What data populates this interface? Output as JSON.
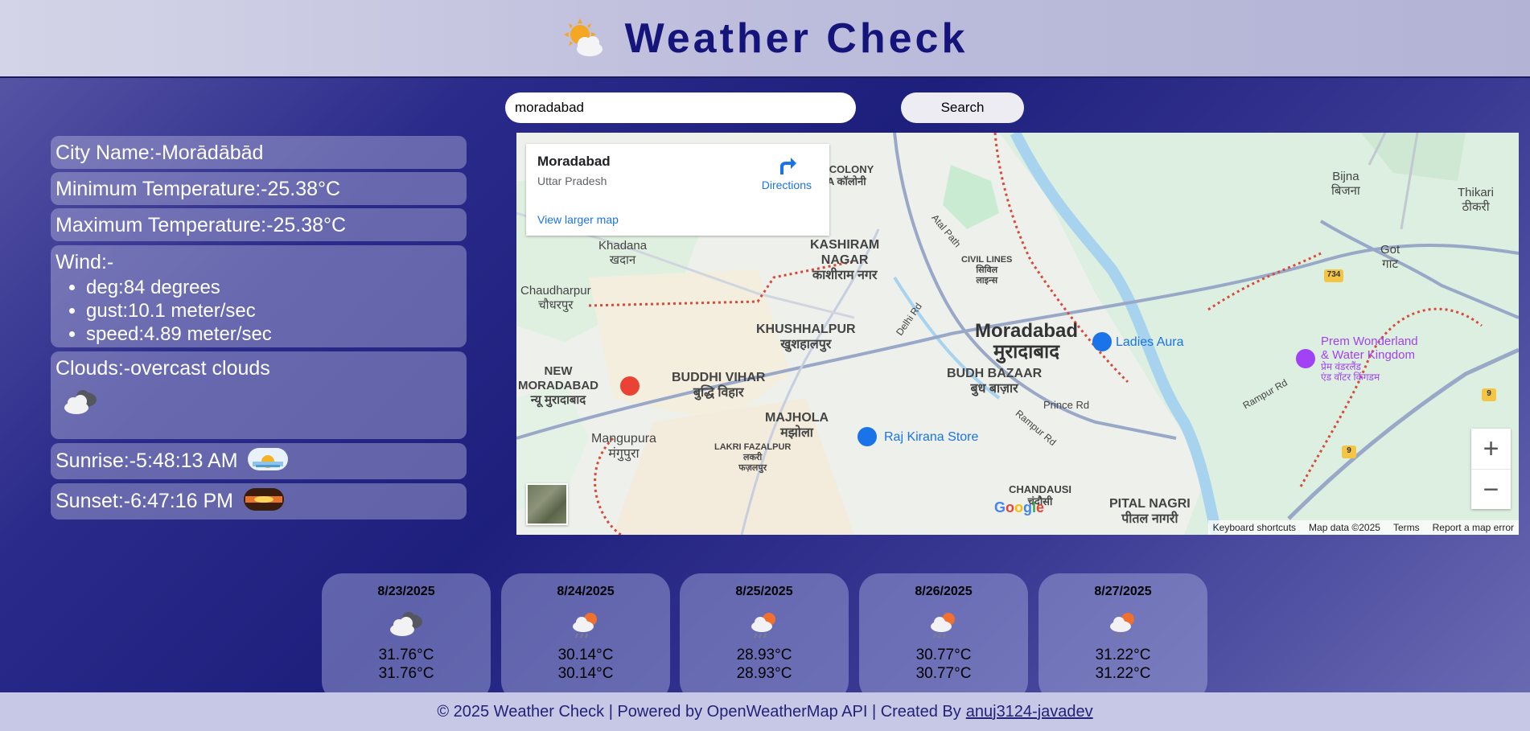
{
  "header": {
    "title": "Weather Check",
    "logo_icon": "sun-cloud-icon"
  },
  "search": {
    "value": "moradabad",
    "button": "Search"
  },
  "info": {
    "city": "City Name:-Morādābād",
    "min_temp": "Minimum Temperature:-25.38°C",
    "max_temp": "Maximum Temperature:-25.38°C",
    "wind_title": "Wind:-",
    "wind_deg": "deg:84 degrees",
    "wind_gust": "gust:10.1 meter/sec",
    "wind_speed": "speed:4.89 meter/sec",
    "clouds": "Clouds:-overcast clouds",
    "sunrise": "Sunrise:-5:48:13 AM",
    "sunset": "Sunset:-6:47:16 PM"
  },
  "map": {
    "place_name": "Moradabad",
    "place_region": "Uttar Pradesh",
    "directions": "Directions",
    "view_larger": "View larger map",
    "city_label_en": "Moradabad",
    "city_label_hi": "मुरादाबाद",
    "footer": {
      "shortcuts": "Keyboard shortcuts",
      "map_data": "Map data ©2025",
      "terms": "Terms",
      "report": "Report a map error"
    },
    "google": "Google",
    "zoom_in": "+",
    "zoom_out": "−",
    "labels": {
      "mda": "MDA COLONY",
      "mda_hi": "MDA कॉलोनी",
      "bijna": "Bijna",
      "bijna_hi": "बिजना",
      "thikari": "Thikari",
      "thikari_hi": "ठीकरी",
      "khadana": "Khadana",
      "khadana_hi": "खदान",
      "kashiram": "KASHIRAM",
      "nagar": "NAGAR",
      "kashiram_hi": "काशीराम नगर",
      "civil": "CIVIL LINES",
      "civil_hi1": "सिविल",
      "civil_hi2": "लाइन्स",
      "got": "Got",
      "got_hi": "गाट",
      "chaudharpur": "Chaudharpur",
      "chaudharpur_hi": "चौधरपुर",
      "khushhalpur": "KHUSHHALPUR",
      "khushhalpur_hi": "खुशहालपुर",
      "ladies": "Ladies Aura",
      "prem1": "Prem Wonderland",
      "prem2": "& Water Kingdom",
      "prem_hi1": "प्रेम वंडरलैंड",
      "prem_hi2": "एंड वॉटर किंगडम",
      "new": "NEW",
      "moradabad": "MORADABAD",
      "new_hi": "न्यू मुरादाबाद",
      "buddhi": "BUDDHI VIHAR",
      "buddhi_hi": "बुद्धि विहार",
      "budh": "BUDH BAZAAR",
      "budh_hi": "बुध बाज़ार",
      "prince": "Prince Rd",
      "majhola": "MAJHOLA",
      "majhola_hi": "मझोला",
      "mangupura": "Mangupura",
      "mangupura_hi": "मंगुपुरा",
      "raj": "Raj Kirana Store",
      "lakri": "LAKRI FAZALPUR",
      "lakri_hi1": "लकरी",
      "lakri_hi2": "फज़लपुर",
      "chandausi": "CHANDAUSI",
      "chandausi_hi": "चंदौसी",
      "pitalnagri": "PITAL NAGRI",
      "pitalnagri_hi": "पीतल नागरी",
      "atal": "Atal Path",
      "delhi": "Delhi Rd",
      "rampur": "Rampur Rd",
      "rampur2": "Rampur Rd",
      "r734": "734",
      "r9a": "9",
      "r9b": "9"
    }
  },
  "forecast": [
    {
      "date": "8/23/2025",
      "icon": "overcast-clouds-icon",
      "t1": "31.76°C",
      "t2": "31.76°C"
    },
    {
      "date": "8/24/2025",
      "icon": "rain-sun-icon",
      "t1": "30.14°C",
      "t2": "30.14°C"
    },
    {
      "date": "8/25/2025",
      "icon": "rain-sun-icon",
      "t1": "28.93°C",
      "t2": "28.93°C"
    },
    {
      "date": "8/26/2025",
      "icon": "rain-sun-icon",
      "t1": "30.77°C",
      "t2": "30.77°C"
    },
    {
      "date": "8/27/2025",
      "icon": "rain-sun-icon",
      "t1": "31.22°C",
      "t2": "31.22°C"
    }
  ],
  "footer": {
    "text": "© 2025 Weather Check | Powered by OpenWeatherMap API | Created By",
    "link": "anuj3124-javadev"
  }
}
